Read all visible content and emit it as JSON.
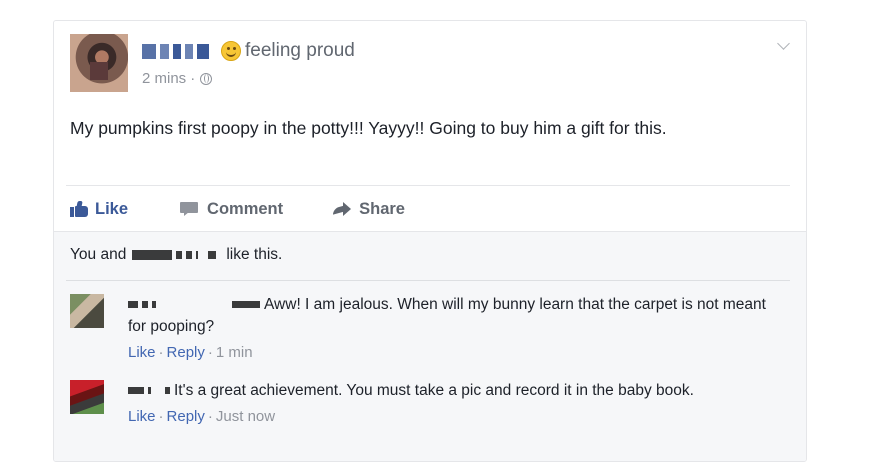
{
  "post": {
    "feeling": "feeling proud",
    "time": "2 mins",
    "meta_separator": "·",
    "text": "My pumpkins first poopy in the potty!!! Yayyy!! Going to buy him a gift for this."
  },
  "actions": {
    "like": "Like",
    "comment": "Comment",
    "share": "Share"
  },
  "likes": {
    "prefix": "You and",
    "suffix": "like this."
  },
  "comments": [
    {
      "text": "Aww! I am jealous. When will my bunny learn that the carpet is not meant for pooping?",
      "like": "Like",
      "reply": "Reply",
      "sep": "·",
      "time": "1 min"
    },
    {
      "text": "It's a great achievement. You must take a pic and record it in the baby book.",
      "like": "Like",
      "reply": "Reply",
      "sep": "·",
      "time": "Just now"
    }
  ],
  "colors": {
    "link_blue": "#3b5998",
    "meta_gray": "#90949c",
    "ufi_background": "#f6f7f9"
  },
  "icons": [
    "feeling-smile-icon",
    "globe-icon",
    "chevron-down-icon",
    "like-thumb-icon",
    "comment-bubble-icon",
    "share-arrow-icon"
  ]
}
